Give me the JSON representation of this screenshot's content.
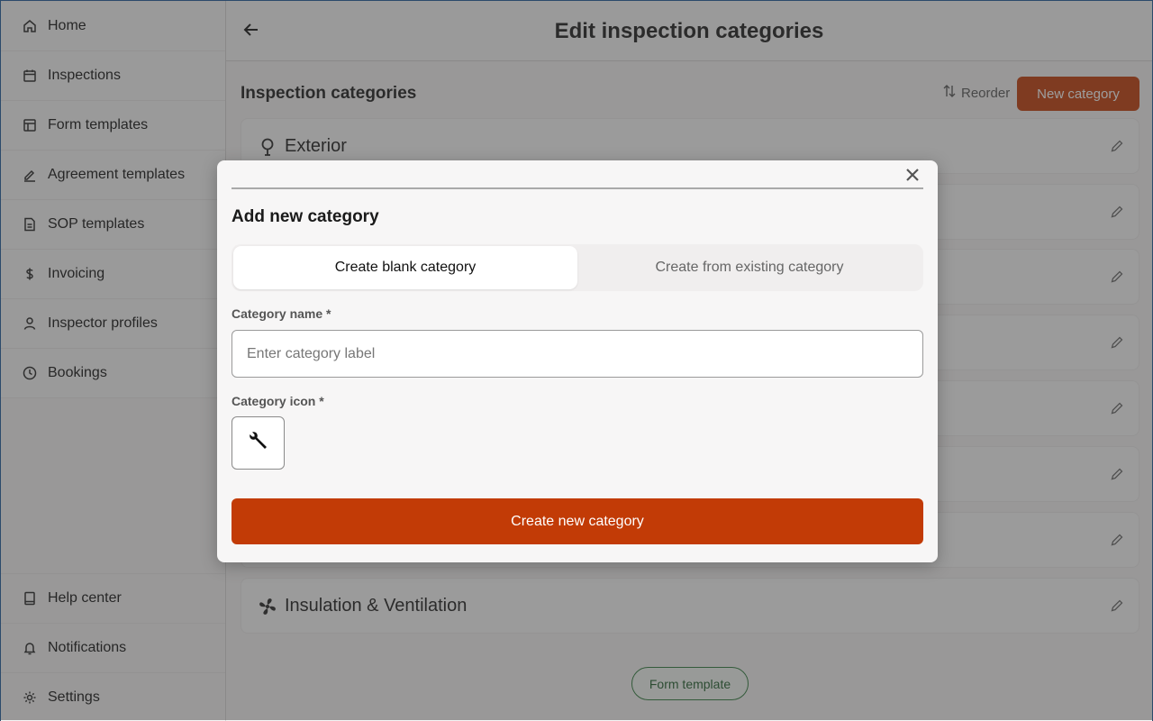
{
  "sidebar": {
    "top_items": [
      {
        "label": "Home",
        "icon": "home-icon"
      },
      {
        "label": "Inspections",
        "icon": "calendar-icon"
      },
      {
        "label": "Form templates",
        "icon": "layout-icon"
      },
      {
        "label": "Agreement templates",
        "icon": "signature-icon"
      },
      {
        "label": "SOP templates",
        "icon": "document-icon"
      },
      {
        "label": "Invoicing",
        "icon": "dollar-icon"
      },
      {
        "label": "Inspector profiles",
        "icon": "user-icon"
      },
      {
        "label": "Bookings",
        "icon": "clock-icon"
      }
    ],
    "bottom_items": [
      {
        "label": "Help center",
        "icon": "book-icon"
      },
      {
        "label": "Notifications",
        "icon": "bell-icon"
      },
      {
        "label": "Settings",
        "icon": "gear-icon"
      }
    ]
  },
  "header": {
    "title": "Edit inspection categories"
  },
  "section": {
    "title": "Inspection categories",
    "reorder_label": "Reorder",
    "new_category_label": "New category"
  },
  "categories": [
    {
      "name": "Exterior",
      "icon": "tree-icon"
    },
    {
      "name": "",
      "icon": ""
    },
    {
      "name": "",
      "icon": ""
    },
    {
      "name": "",
      "icon": ""
    },
    {
      "name": "",
      "icon": ""
    },
    {
      "name": "",
      "icon": ""
    },
    {
      "name": "",
      "icon": ""
    },
    {
      "name": "Insulation & Ventilation",
      "icon": "fan-icon"
    }
  ],
  "footer": {
    "form_template_label": "Form template"
  },
  "modal": {
    "title": "Add new category",
    "tabs": [
      {
        "label": "Create blank category",
        "active": true
      },
      {
        "label": "Create from existing category",
        "active": false
      }
    ],
    "name_label": "Category name *",
    "name_value": "",
    "name_placeholder": "Enter category label",
    "icon_label": "Category icon *",
    "selected_icon": "wrench-icon",
    "submit_label": "Create new category"
  },
  "colors": {
    "accent": "#c23b06",
    "form_template_border": "#2c7a3a"
  }
}
